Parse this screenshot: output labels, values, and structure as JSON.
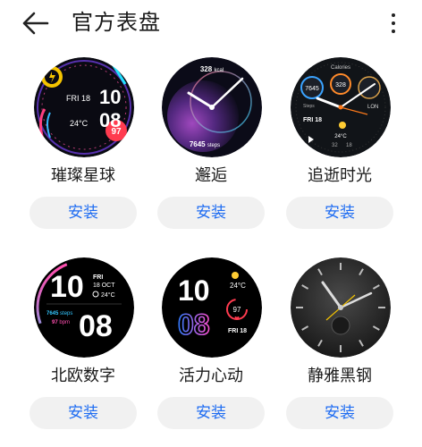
{
  "header": {
    "title": "官方表盘",
    "back_icon": "arrow-left-icon",
    "more_icon": "more-vertical-icon"
  },
  "colors": {
    "accent": "#1e6cf2",
    "button_bg": "#f1f1f1"
  },
  "watch_faces": [
    {
      "name": "璀璨星球",
      "install_label": "安装",
      "display": {
        "day": "FRI 18",
        "hour": "10",
        "minute": "08",
        "weather": "24°C",
        "heart_rate": "97"
      }
    },
    {
      "name": "邂逅",
      "install_label": "安装",
      "display": {
        "calories": "328",
        "calories_unit": "kcal",
        "steps": "7645",
        "steps_unit": "steps"
      }
    },
    {
      "name": "追逝时光",
      "install_label": "安装",
      "display": {
        "top_label": "Calories",
        "steps": "7645",
        "calories": "328",
        "steps_label": "Steps",
        "city": "LON",
        "day": "FRI 18",
        "temp": "24°C",
        "low": "32",
        "high": "18"
      }
    },
    {
      "name": "北欧数字",
      "install_label": "安装",
      "display": {
        "hour": "10",
        "minute": "08",
        "weekday": "FRI",
        "date": "18 OCT",
        "temp": "24°C",
        "steps": "7645",
        "steps_unit": "steps",
        "bpm": "97",
        "bpm_unit": "bpm"
      }
    },
    {
      "name": "活力心动",
      "install_label": "安装",
      "display": {
        "hour": "10",
        "minute": "08",
        "temp": "24°C",
        "heart_rate": "97",
        "day": "FRI 18"
      }
    },
    {
      "name": "静雅黑钢",
      "install_label": "安装",
      "display": {}
    }
  ]
}
